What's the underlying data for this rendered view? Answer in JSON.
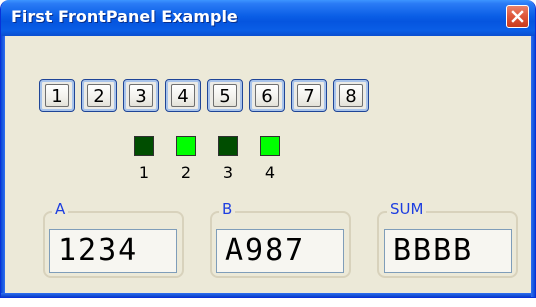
{
  "window": {
    "title": "First FrontPanel Example",
    "close_icon": "close-icon"
  },
  "buttons": [
    "1",
    "2",
    "3",
    "4",
    "5",
    "6",
    "7",
    "8"
  ],
  "leds": [
    {
      "label": "1",
      "state": "off",
      "color": "#004d00"
    },
    {
      "label": "2",
      "state": "on",
      "color": "#00ff00"
    },
    {
      "label": "3",
      "state": "off",
      "color": "#004d00"
    },
    {
      "label": "4",
      "state": "on",
      "color": "#00ff00"
    }
  ],
  "displays": [
    {
      "label": "A",
      "value": "1234"
    },
    {
      "label": "B",
      "value": "A987"
    },
    {
      "label": "SUM",
      "value": "BBBB"
    }
  ],
  "colors": {
    "titlebar": "#0a5ee6",
    "group_label": "#1d3ee0",
    "led_on": "#00ff00",
    "led_off": "#004d00"
  }
}
